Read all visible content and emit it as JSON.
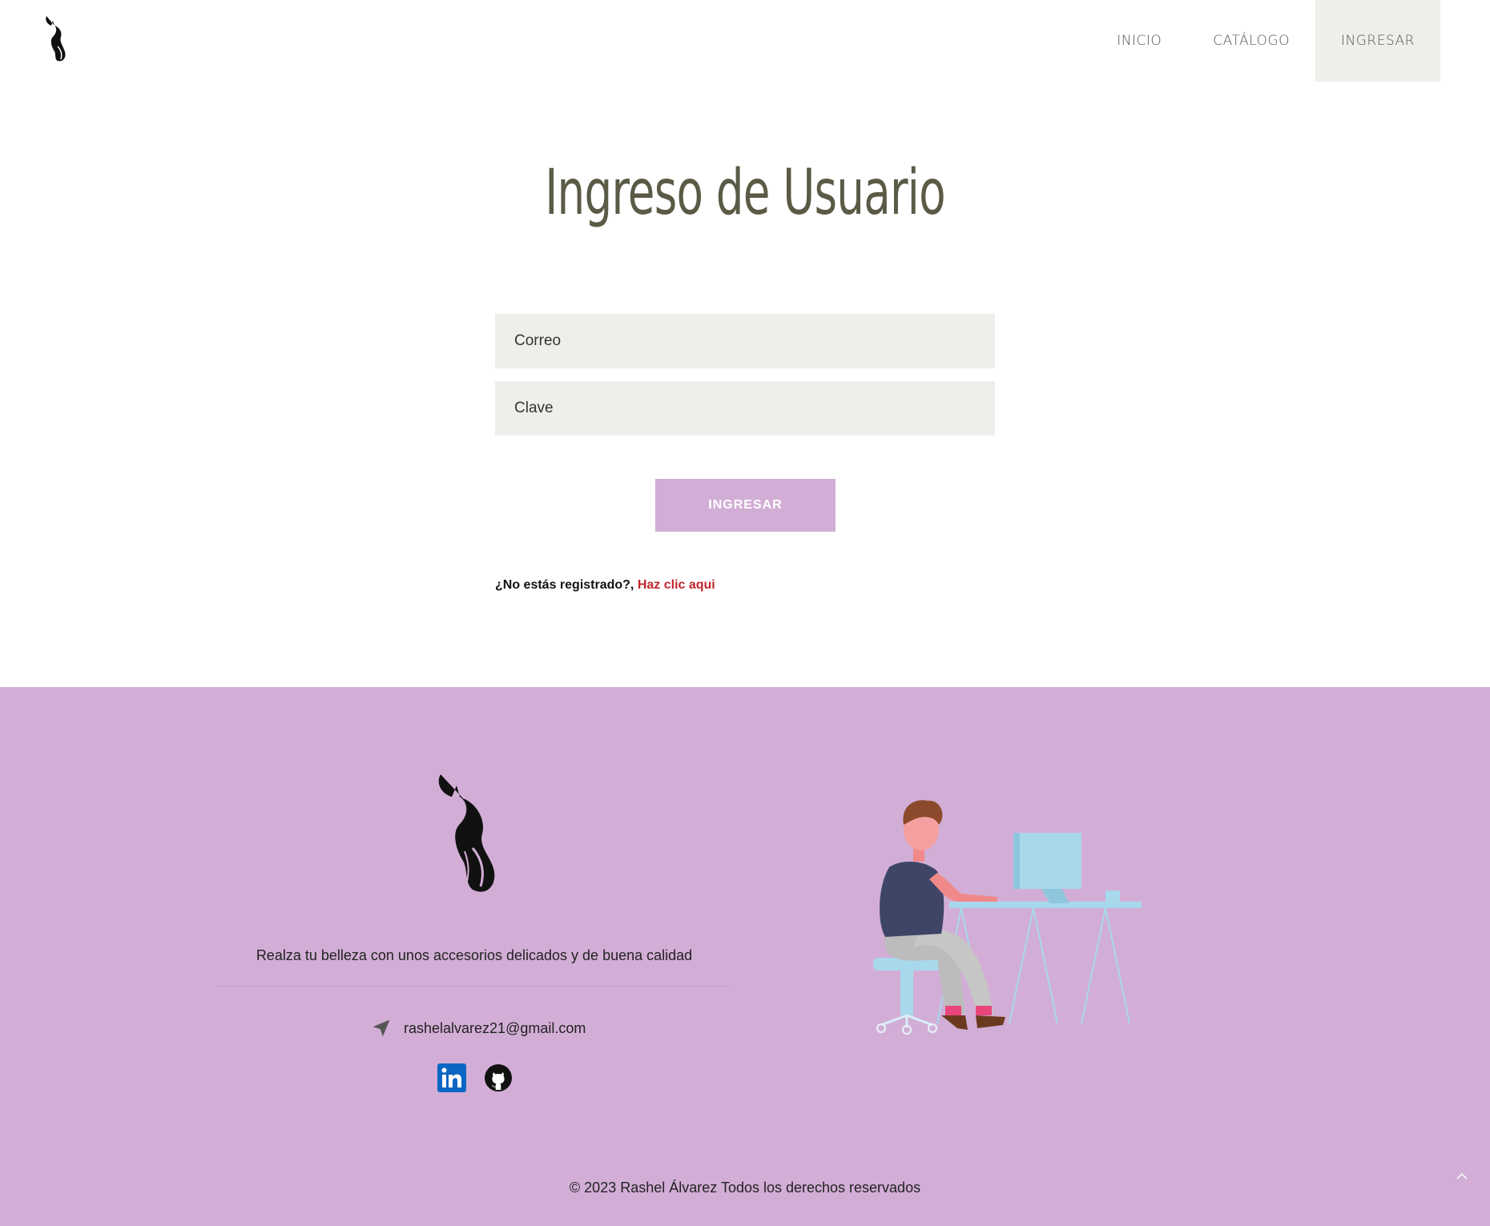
{
  "nav": {
    "items": [
      {
        "label": "INICIO",
        "active": false
      },
      {
        "label": "CATÁLOGO",
        "active": false
      },
      {
        "label": "INGRESAR",
        "active": true
      }
    ]
  },
  "login": {
    "title": "Ingreso de Usuario",
    "email_placeholder": "Correo",
    "password_placeholder": "Clave",
    "submit_label": "INGRESAR",
    "register_prompt": "¿No estás registrado?,",
    "register_link": "Haz clic aqui"
  },
  "footer": {
    "tagline": "Realza tu belleza con unos accesorios delicados y de buena calidad",
    "email": "rashelalvarez21@gmail.com",
    "social": [
      "linkedin-icon",
      "github-icon"
    ],
    "copyright": "© 2023 Rashel Álvarez Todos los derechos reservados"
  },
  "colors": {
    "accent": "#d2aed6",
    "field_bg": "#efeeea",
    "title": "#5b5a46",
    "link": "#c0262d"
  }
}
